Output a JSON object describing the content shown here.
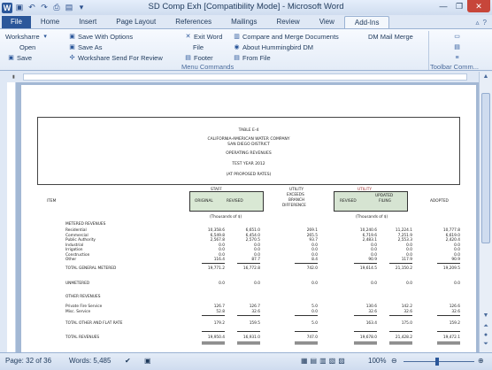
{
  "window": {
    "title": "SD Comp Exh [Compatibility Mode] - Microsoft Word"
  },
  "tabs": [
    "File",
    "Home",
    "Insert",
    "Page Layout",
    "References",
    "Mailings",
    "Review",
    "View",
    "Add-Ins"
  ],
  "ribbon": {
    "col1": [
      "Worksharre",
      "Open",
      "Save"
    ],
    "col2": [
      "Save With Options",
      "Save As",
      "Workshare Send For Review"
    ],
    "col3": [
      "Exit Word",
      "File",
      "Footer"
    ],
    "col4": [
      "Compare and Merge Documents",
      "About Hummingbird DM",
      "From File"
    ],
    "col5": "DM Mail Merge",
    "group_menu": "Menu Commands",
    "group_toolbar": "Toolbar Comm..."
  },
  "document": {
    "table_no": "TABLE E-4",
    "company": "CALIFORNIA-AMERICAN WATER COMPANY",
    "district": "SAN DIEGO DISTRICT",
    "subtitle": "OPERATING REVENUES",
    "test_year": "TEST YEAR 2012",
    "rates": "(AT PROPOSED RATES)",
    "col_item": "ITEM",
    "group_staff": "STAFF",
    "group_utility": "UTILITY",
    "col_original": "ORIGINAL",
    "col_revised": "REVISED",
    "col_exceeds": [
      "UTILITY",
      "EXCEEDS",
      "BRANCH",
      "DIFFERENCE"
    ],
    "col_revised2": "REVISED",
    "col_updated": [
      "UPDATED",
      "FILING"
    ],
    "col_adopted": "ADOPTED",
    "units1": "(Thousands of $)",
    "units2": "(Thousands of $)",
    "section_metered": "METERED REVENUES",
    "rows": [
      {
        "label": "Residential",
        "v": [
          "10,358.6",
          "6,651.0",
          "269.1",
          "10,240.6",
          "11,224.1",
          "10,777.8"
        ]
      },
      {
        "label": "Commercial",
        "v": [
          "6,549.8",
          "6,454.0",
          "265.5",
          "6,719.6",
          "7,251.9",
          "6,619.0"
        ]
      },
      {
        "label": "Public Authority",
        "v": [
          "2,567.8",
          "2,570.5",
          "93.7",
          "2,483.1",
          "2,553.3",
          "2,420.4"
        ]
      },
      {
        "label": "Industrial",
        "v": [
          "0.0",
          "0.0",
          "0.0",
          "0.0",
          "0.0",
          "0.0"
        ]
      },
      {
        "label": "Irrigation",
        "v": [
          "0.0",
          "0.0",
          "0.0",
          "0.0",
          "0.0",
          "0.0"
        ]
      },
      {
        "label": "Construction",
        "v": [
          "0.0",
          "0.0",
          "0.0",
          "0.0",
          "0.0",
          "0.0"
        ]
      },
      {
        "label": "Other",
        "v": [
          "116.4",
          "87.7",
          "8.4",
          "90.9",
          "117.9",
          "90.9"
        ]
      }
    ],
    "total_metered": {
      "label": "TOTAL GENERAL METERED",
      "v": [
        "19,771.2",
        "16,772.8",
        "742.0",
        "19,614.5",
        "21,150.2",
        "19,209.5"
      ]
    },
    "unmetered": {
      "label": "UNMETERED",
      "v": [
        "0.0",
        "0.0",
        "0.0",
        "0.0",
        "0.0",
        "0.0"
      ]
    },
    "section_other": "OTHER REVENUES",
    "other_rows": [
      {
        "label": "Private Fire Service",
        "v": [
          "126.7",
          "126.7",
          "5.0",
          "130.6",
          "142.2",
          "126.6"
        ]
      },
      {
        "label": "Misc. Service",
        "v": [
          "52.8",
          "32.6",
          "0.0",
          "32.6",
          "32.6",
          "32.6"
        ]
      }
    ],
    "total_other": {
      "label": "TOTAL OTHER AND FLAT RATE",
      "v": [
        "179.2",
        "159.5",
        "5.0",
        "163.4",
        "175.0",
        "159.2"
      ]
    },
    "total_revenues": {
      "label": "TOTAL REVENUES",
      "v": [
        "19,950.4",
        "16,931.0",
        "747.0",
        "19,678.0",
        "21,428.2",
        "19,472.1"
      ]
    }
  },
  "status": {
    "page": "Page: 32 of 36",
    "words": "Words: 5,485",
    "zoom": "100%"
  },
  "colors": {
    "file_tab": "#2b579a",
    "close": "#c7463a",
    "staff_box": "#d9e8d4",
    "utility_box": "#d6e4d2"
  }
}
